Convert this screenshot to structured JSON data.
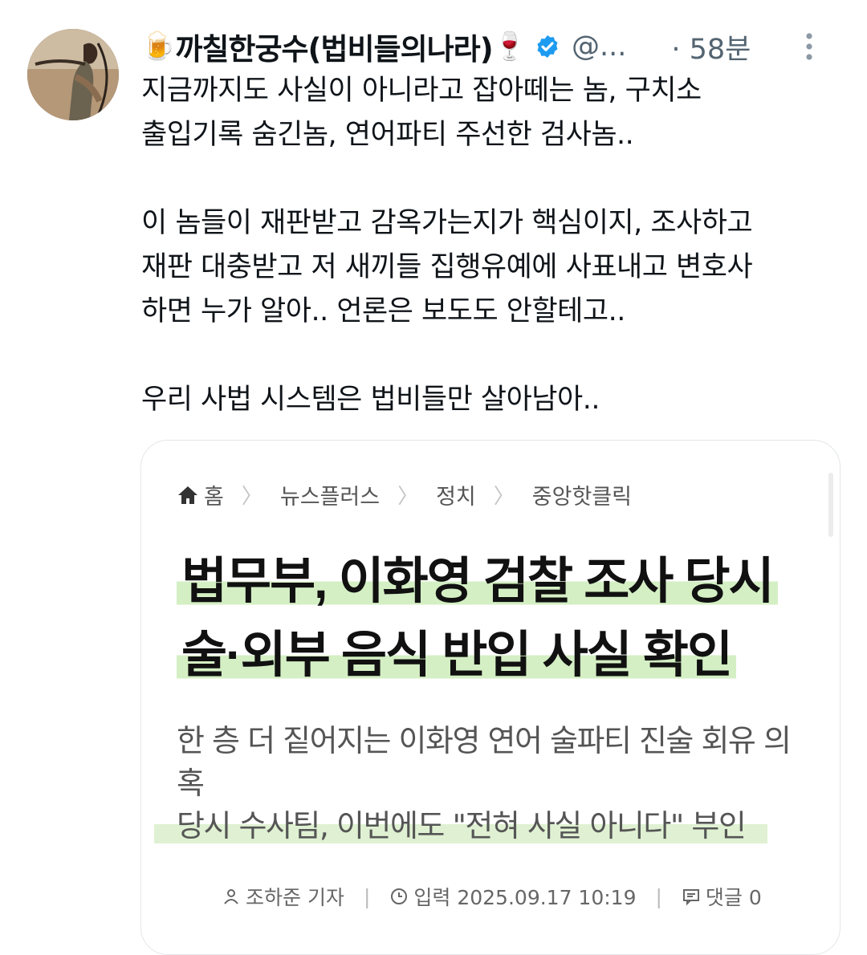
{
  "tweet": {
    "author": {
      "display_name": "까칠한궁수(법비들의나라)",
      "emoji_before": "🍺",
      "emoji_after": "🍷",
      "handle": "@...",
      "time": "· 58분"
    },
    "text": "지금까지도 사실이 아니라고 잡아떼는 놈, 구치소\n출입기록 숨긴놈, 연어파티 주선한 검사놈..\n\n이 놈들이 재판받고 감옥가는지가 핵심이지, 조사하고\n재판 대충받고 저 새끼들 집행유예에 사표내고 변호사\n하면 누가 알아.. 언론은 보도도 안할테고..\n\n우리 사법 시스템은 법비들만 살아남아.."
  },
  "card": {
    "breadcrumb": [
      "홈",
      "뉴스플러스",
      "정치",
      "중앙핫클릭"
    ],
    "headline": [
      "법무부, 이화영 검찰 조사 당시",
      "술·외부 음식 반입 사실 확인"
    ],
    "subhead_line1": "한 층 더 짙어지는 이화영 연어 술파티 진술 회유 의",
    "subhead_line2": "혹",
    "subhead_line3": "당시 수사팀, 이번에도 \"전혀 사실 아니다\" 부인",
    "reporter": "조하준 기자",
    "date": "입력 2025.09.17 10:19",
    "comments": "댓글 0"
  },
  "icons": [
    "verified-badge-icon",
    "more-vertical-icon",
    "home-icon",
    "person-icon",
    "clock-icon",
    "comment-icon"
  ],
  "colors": {
    "verified": "#1d9bf0",
    "highlight": "#d4efc4",
    "secondary_text": "#536471"
  }
}
